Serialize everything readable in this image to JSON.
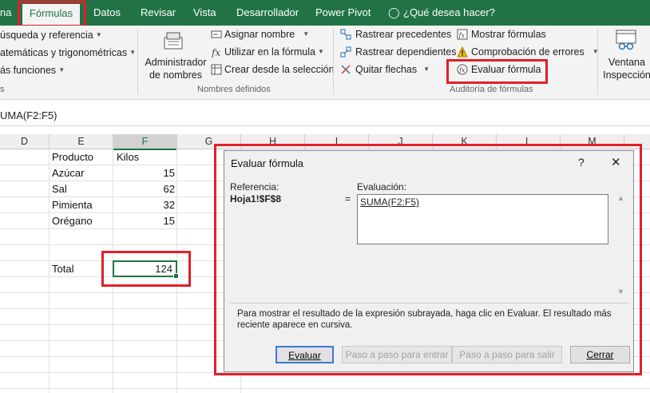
{
  "tabs": {
    "inicio_partial": "na",
    "formulas": "Fórmulas",
    "datos": "Datos",
    "revisar": "Revisar",
    "vista": "Vista",
    "desarrollador": "Desarrollador",
    "power_pivot": "Power Pivot",
    "tell_me": "¿Qué desea hacer?"
  },
  "ribbon": {
    "left_group": {
      "busqueda": "úsqueda y referencia",
      "matematicas": "atemáticas y trigonométricas",
      "mas_funciones": "ás funciones",
      "label_partial": "s"
    },
    "nombres_definidos": {
      "admin_line1": "Administrador",
      "admin_line2": "de nombres",
      "asignar": "Asignar nombre",
      "utilizar": "Utilizar en la fórmula",
      "crear": "Crear desde la selección",
      "label": "Nombres definidos"
    },
    "auditoria": {
      "rastrear_prec": "Rastrear precedentes",
      "rastrear_dep": "Rastrear dependientes",
      "quitar_flechas": "Quitar flechas",
      "mostrar_formulas": "Mostrar fórmulas",
      "comprobacion": "Comprobación de errores",
      "evaluar": "Evaluar fórmula",
      "label": "Auditoría de fórmulas"
    },
    "ventana": {
      "line1": "Ventana",
      "line2": "Inspección"
    }
  },
  "formula_bar": {
    "content": "UMA(F2:F5)"
  },
  "sheet": {
    "columns": [
      "D",
      "E",
      "F",
      "G",
      "H",
      "I",
      "J",
      "K",
      "L",
      "M"
    ],
    "header_row": {
      "producto": "Producto",
      "kilos": "Kilos"
    },
    "rows": [
      {
        "producto": "Azúcar",
        "kilos": "15"
      },
      {
        "producto": "Sal",
        "kilos": "62"
      },
      {
        "producto": "Pimienta",
        "kilos": "32"
      },
      {
        "producto": "Orégano",
        "kilos": "15"
      }
    ],
    "total_label": "Total",
    "total_value": "124"
  },
  "dialog": {
    "title": "Evaluar fórmula",
    "help": "?",
    "close": "✕",
    "referencia_label": "Referencia:",
    "referencia_value": "Hoja1!$F$8",
    "equals": "=",
    "evaluacion_label": "Evaluación:",
    "evaluacion_value": "SUMA(F2:F5)",
    "info_text": "Para mostrar el resultado de la expresión subrayada, haga clic en Evaluar. El resultado más reciente aparece en cursiva.",
    "btn_evaluar": "Evaluar",
    "btn_entrar": "Paso a paso para entrar",
    "btn_salir": "Paso a paso para salir",
    "btn_cerrar": "Cerrar"
  },
  "colors": {
    "excel_green": "#217346",
    "highlight_red": "#e0202a"
  }
}
